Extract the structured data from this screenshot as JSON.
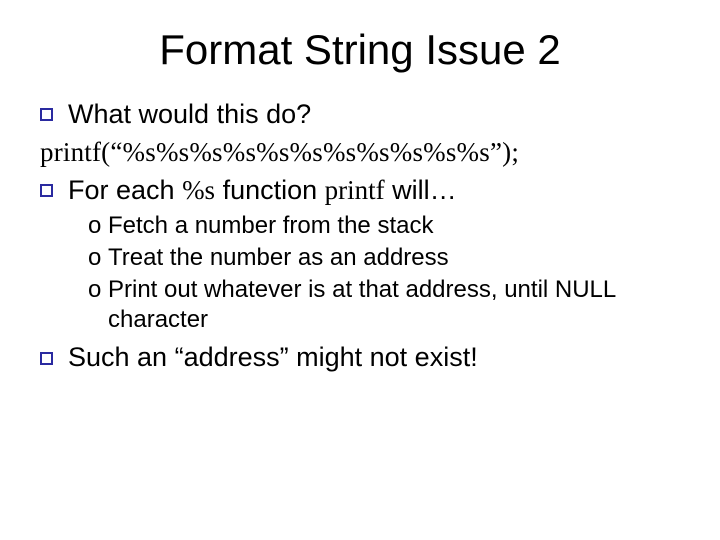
{
  "title": "Format String Issue 2",
  "bullets": {
    "b1": "What would this do?",
    "code": "printf(“%s%s%s%s%s%s%s%s%s%s%s”);",
    "b2_prefix": "For each ",
    "b2_pct": "%s",
    "b2_mid": " function ",
    "b2_printf": "printf",
    "b2_suffix": " will…",
    "b3": "Such an “address” might not exist!"
  },
  "sub": {
    "o_marker": "o",
    "s1": "Fetch a number from the stack",
    "s2": "Treat the number as an address",
    "s3": "Print out whatever is at that address, until NULL character"
  }
}
